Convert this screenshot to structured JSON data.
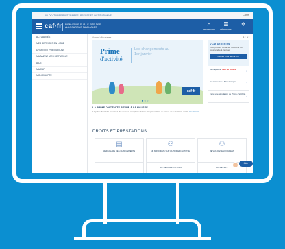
{
  "topbar": {
    "links": [
      "ALLOCATAIRES",
      "PARTENAIRES",
      "PRESSE ET INSTITUTIONNEL"
    ],
    "account": "Caf.fr"
  },
  "header": {
    "logo": "caf·fr",
    "tagline": "BIENVENUE SUR LE SITE DES ALLOCATIONS FAMILIALES",
    "icons": [
      {
        "icon": "search-icon",
        "label": "RECHERCHE"
      },
      {
        "icon": "list-icon",
        "label": "DÉMARCHES"
      },
      {
        "icon": "gear-icon",
        "label": ""
      }
    ]
  },
  "sidebar": {
    "items": [
      "ACTUALITÉS",
      "MES SERVICES EN LIGNE",
      "DROITS ET PRESTATIONS",
      "MAGAZINE VIES DE FAMILLE",
      "AIDE",
      "MA CAF",
      "MON COMPTE"
    ]
  },
  "breadcrumb": "Accueil allocataires",
  "font_controls": "A⁻ A⁺",
  "hero": {
    "prime": "Prime",
    "activite": "d'activité",
    "changes": "Les changements au 1er janvier",
    "badge": "caf·fr"
  },
  "news": {
    "title": "LA PRIME D'ACTIVITÉ REVUE À LA HAUSSE",
    "body": "La prime d'activité s'ouvre à des revenus complémentaires d'augmentation du bonus et de certains droits. ",
    "more": "Lire la suite"
  },
  "right_panel": {
    "access_title": "CAF DE TEST 91",
    "access_desc": "Vous pouvez contacter votre Caf ou vous rendre à l'accueil",
    "access_button": "Voir les infos de ma Caf",
    "rows": [
      {
        "prefix": "Le magazine",
        "brand": "vies de famille"
      },
      {
        "prefix": "Se connecter à Mon Compte",
        "brand": ""
      },
      {
        "prefix": "Faire une simulation de Prime d'activité",
        "brand": ""
      }
    ]
  },
  "droits": {
    "title": "DROITS ET PRESTATIONS",
    "cards": [
      "JE DÉCLARE DES CHANGEMENTS",
      "JE M'INFORME SUR LA PRIME D'ACTIVITÉ",
      "JE VAIS DEVENIR PARENT"
    ],
    "more_cards": [
      "",
      "AUTRES PRESTATIONS",
      "AUTRES EL..."
    ]
  },
  "chat": {
    "label": "Aide"
  },
  "colors": {
    "primary": "#1d5ea6",
    "background": "#0b8fd1",
    "accent": "#e8423f"
  }
}
